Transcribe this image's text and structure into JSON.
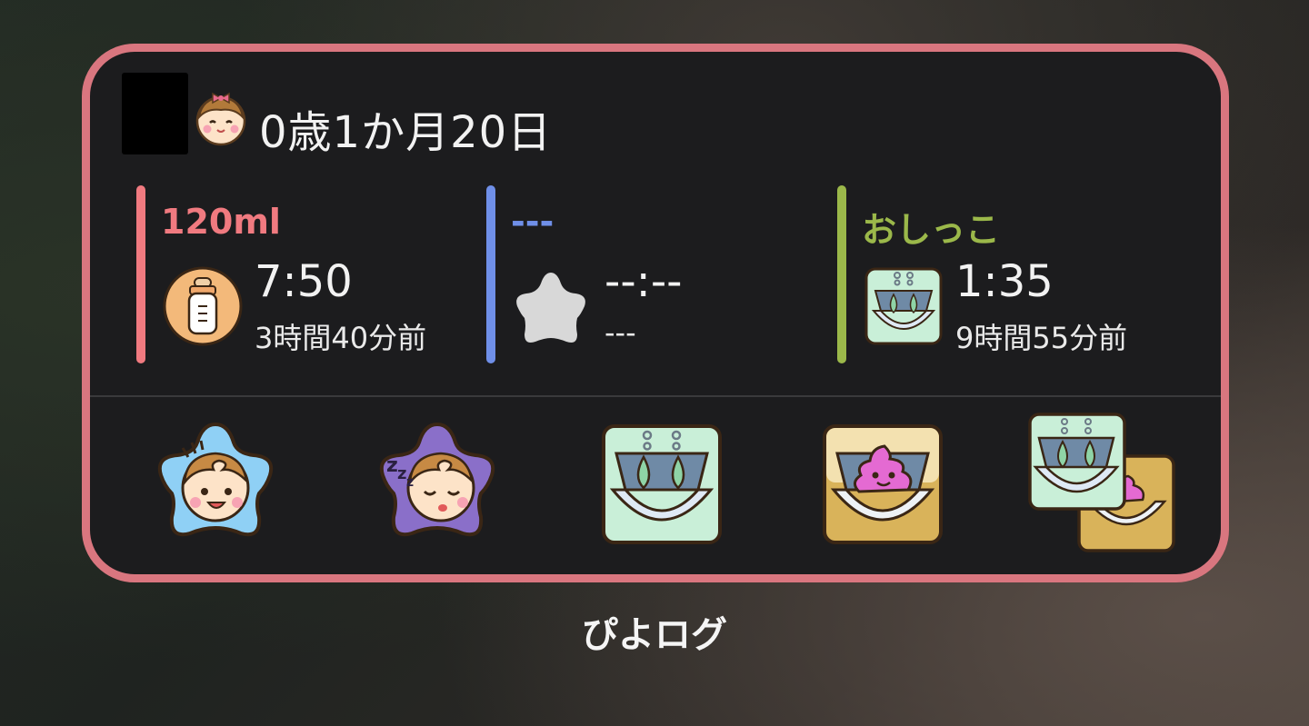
{
  "widget": {
    "age": "0歳1か月20日",
    "columns": [
      {
        "title": "120ml",
        "time": "7:50",
        "ago": "3時間40分前",
        "color": "#f07a80",
        "icon": "baby-bottle-icon"
      },
      {
        "title": "---",
        "time": "--:--",
        "ago": "---",
        "color": "#6f8fe8",
        "icon": "empty-star-icon"
      },
      {
        "title": "おしっこ",
        "time": "1:35",
        "ago": "9時間55分前",
        "color": "#9bb84a",
        "icon": "diaper-pee-icon"
      }
    ],
    "buttons": [
      {
        "icon": "awake-baby-icon"
      },
      {
        "icon": "sleeping-baby-icon"
      },
      {
        "icon": "diaper-pee-icon"
      },
      {
        "icon": "diaper-poop-icon"
      },
      {
        "icon": "diaper-both-icon"
      }
    ],
    "border_color": "#d9767f"
  },
  "app_name": "ぴよログ"
}
